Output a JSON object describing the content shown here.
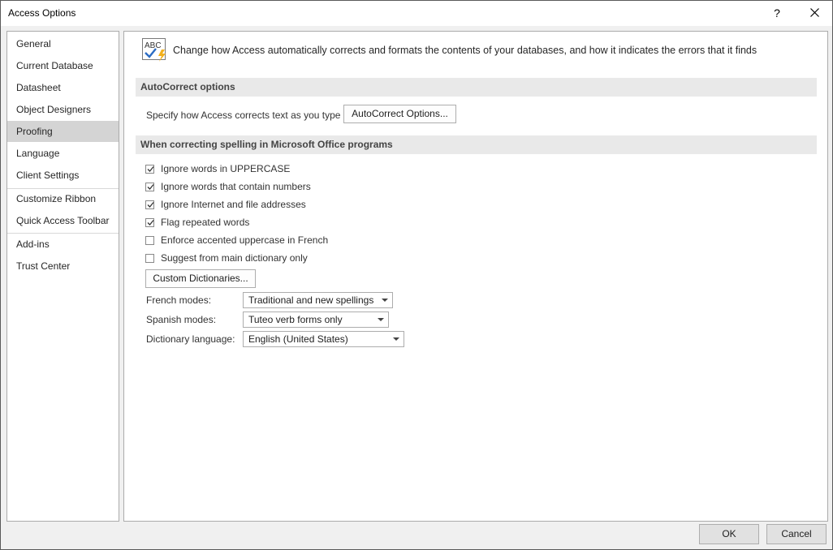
{
  "window": {
    "title": "Access Options",
    "help_label": "?"
  },
  "sidebar": {
    "items": [
      {
        "label": "General"
      },
      {
        "label": "Current Database"
      },
      {
        "label": "Datasheet"
      },
      {
        "label": "Object Designers"
      },
      {
        "label": "Proofing",
        "selected": true
      },
      {
        "label": "Language"
      },
      {
        "label": "Client Settings"
      },
      {
        "label": "Customize Ribbon"
      },
      {
        "label": "Quick Access Toolbar"
      },
      {
        "label": "Add-ins"
      },
      {
        "label": "Trust Center"
      }
    ]
  },
  "main": {
    "intro": "Change how Access automatically corrects and formats the contents of your databases, and how it indicates the errors that it finds",
    "icon": "abc-proofing-icon",
    "autocorrect": {
      "header": "AutoCorrect options",
      "description": "Specify how Access corrects text as you type",
      "button_label": "AutoCorrect Options..."
    },
    "spelling": {
      "header": "When correcting spelling in Microsoft Office programs",
      "options": [
        {
          "label": "Ignore words in UPPERCASE",
          "checked": true
        },
        {
          "label": "Ignore words that contain numbers",
          "checked": true
        },
        {
          "label": "Ignore Internet and file addresses",
          "checked": true
        },
        {
          "label": "Flag repeated words",
          "checked": true
        },
        {
          "label": "Enforce accented uppercase in French",
          "checked": false
        },
        {
          "label": "Suggest from main dictionary only",
          "checked": false
        }
      ],
      "custom_dict_button": "Custom Dictionaries...",
      "french_modes_label": "French modes:",
      "french_modes_value": "Traditional and new spellings",
      "spanish_modes_label": "Spanish modes:",
      "spanish_modes_value": "Tuteo verb forms only",
      "dictionary_language_label": "Dictionary language:",
      "dictionary_language_value": "English (United States)"
    }
  },
  "footer": {
    "ok_label": "OK",
    "cancel_label": "Cancel"
  },
  "colors": {
    "selected_nav": "#d4d4d4",
    "section_header_bg": "#e9e9e9",
    "window_bg": "#f0f0f0"
  }
}
